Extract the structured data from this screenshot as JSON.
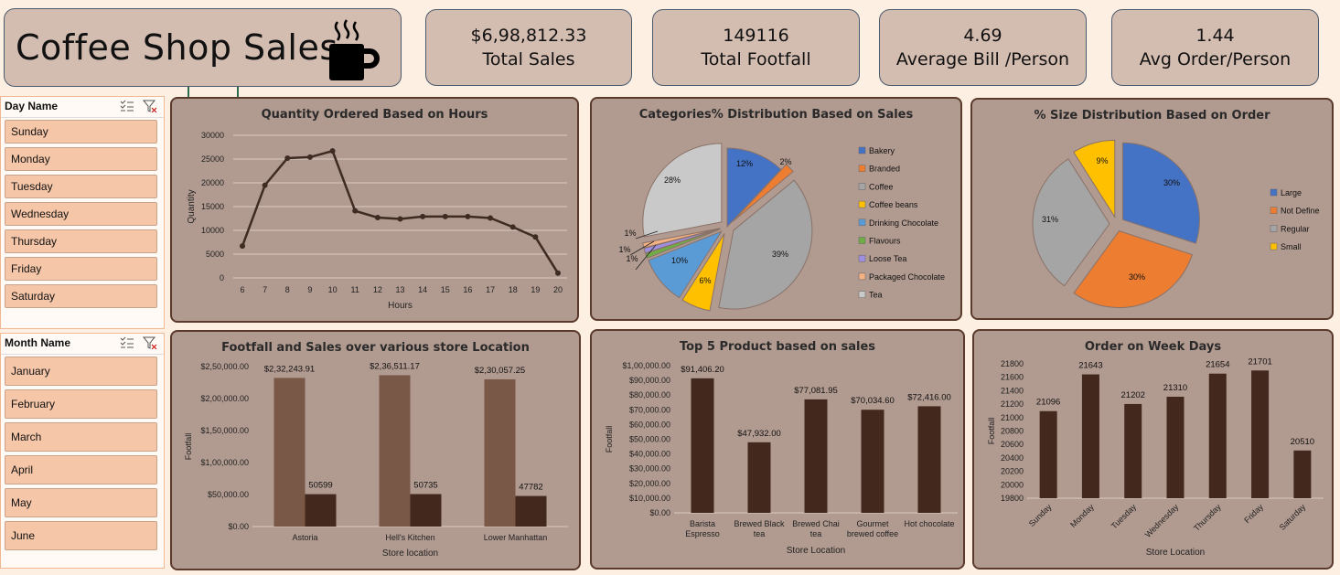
{
  "header": {
    "title": "Coffee Shop Sales"
  },
  "kpis": [
    {
      "value": "$6,98,812.33",
      "label": "Total Sales"
    },
    {
      "value": "149116",
      "label": "Total Footfall"
    },
    {
      "value": "4.69",
      "label": "Average Bill /Person"
    },
    {
      "value": "1.44",
      "label": "Avg Order/Person"
    }
  ],
  "day_slicer": {
    "title": "Day Name",
    "items": [
      "Sunday",
      "Monday",
      "Tuesday",
      "Wednesday",
      "Thursday",
      "Friday",
      "Saturday"
    ]
  },
  "month_slicer": {
    "title": "Month Name",
    "items": [
      "January",
      "February",
      "March",
      "April",
      "May",
      "June"
    ]
  },
  "chart_data": [
    {
      "type": "line",
      "title": "Quantity  Ordered Based on Hours",
      "xlabel": "Hours",
      "ylabel": "Quantity",
      "x": [
        6,
        7,
        8,
        9,
        10,
        11,
        12,
        13,
        14,
        15,
        16,
        17,
        18,
        19,
        20
      ],
      "values": [
        6700,
        19500,
        25200,
        25400,
        26700,
        14100,
        12700,
        12400,
        12900,
        12900,
        12900,
        12600,
        10700,
        8600,
        1000
      ],
      "ylim": [
        0,
        30000
      ],
      "yticks": [
        0,
        5000,
        10000,
        15000,
        20000,
        25000,
        30000
      ],
      "color": "#3e2b22"
    },
    {
      "type": "pie",
      "title": "Categories% Distribution Based on Sales",
      "labels": [
        "Bakery",
        "Branded",
        "Coffee",
        "Coffee beans",
        "Drinking Chocolate",
        "Flavours",
        "Loose Tea",
        "Packaged Chocolate",
        "Tea"
      ],
      "values": [
        12,
        2,
        39,
        6,
        10,
        1,
        1,
        1,
        28
      ],
      "data_labels": [
        "12%",
        "2%",
        "39%",
        "6%",
        "10%",
        "1%",
        "1%",
        "1%",
        "28%"
      ],
      "colors": [
        "#4472c4",
        "#ed7d31",
        "#a5a5a5",
        "#ffc000",
        "#5b9bd5",
        "#70ad47",
        "#9e8fe0",
        "#f4b183",
        "#c9c9c9"
      ],
      "legend": "right"
    },
    {
      "type": "pie",
      "title": "% Size Distribution Based on Order",
      "labels": [
        "Large",
        "Not Define",
        "Regular",
        "Small"
      ],
      "values": [
        30,
        30,
        31,
        9
      ],
      "data_labels": [
        "30%",
        "30%",
        "31%",
        "9%"
      ],
      "colors": [
        "#4472c4",
        "#ed7d31",
        "#a5a5a5",
        "#ffc000"
      ],
      "legend": "right"
    },
    {
      "type": "bar",
      "title": "Footfall and Sales over various store Location",
      "xlabel": "Store location",
      "ylabel": "Footfall",
      "categories": [
        "Astoria",
        "Hell's Kitchen",
        "Lower Manhattan"
      ],
      "series": [
        {
          "values": [
            232243.91,
            236511.17,
            230057.25
          ],
          "labels": [
            "$2,32,243.91",
            "$2,36,511.17",
            "$2,30,057.25"
          ],
          "color": "#7a5848"
        },
        {
          "values": [
            50599,
            50735,
            47782
          ],
          "labels": [
            "50599",
            "50735",
            "47782"
          ],
          "color": "#43291d"
        }
      ],
      "ylim": [
        0,
        250000
      ],
      "yticks": [
        "$0.00",
        "$50,000.00",
        "$1,00,000.00",
        "$1,50,000.00",
        "$2,00,000.00",
        "$2,50,000.00"
      ]
    },
    {
      "type": "bar",
      "title": "Top 5 Product based on sales",
      "xlabel": "Store Location",
      "ylabel": "Footfall",
      "categories": [
        "Barista Espresso",
        "Brewed Black tea",
        "Brewed Chai tea",
        "Gourmet brewed coffee",
        "Hot chocolate"
      ],
      "values": [
        91406.2,
        47932.0,
        77081.95,
        70034.6,
        72416.0
      ],
      "data_labels": [
        "$91,406.20",
        "$47,932.00",
        "$77,081.95",
        "$70,034.60",
        "$72,416.00"
      ],
      "ylim": [
        0,
        100000
      ],
      "yticks": [
        "$0.00",
        "$10,000.00",
        "$20,000.00",
        "$30,000.00",
        "$40,000.00",
        "$50,000.00",
        "$60,000.00",
        "$70,000.00",
        "$80,000.00",
        "$90,000.00",
        "$1,00,000.00"
      ],
      "color": "#43291d"
    },
    {
      "type": "bar",
      "title": "Order on Week Days",
      "xlabel": "Store Location",
      "ylabel": "Footfall",
      "categories": [
        "Sunday",
        "Monday",
        "Tuesday",
        "Wednesday",
        "Thursday",
        "Friday",
        "Saturday"
      ],
      "values": [
        21096,
        21643,
        21202,
        21310,
        21654,
        21701,
        20510
      ],
      "ylim": [
        19800,
        21800
      ],
      "yticks": [
        19800,
        20000,
        20200,
        20400,
        20600,
        20800,
        21000,
        21200,
        21400,
        21600,
        21800
      ],
      "color": "#43291d"
    }
  ]
}
